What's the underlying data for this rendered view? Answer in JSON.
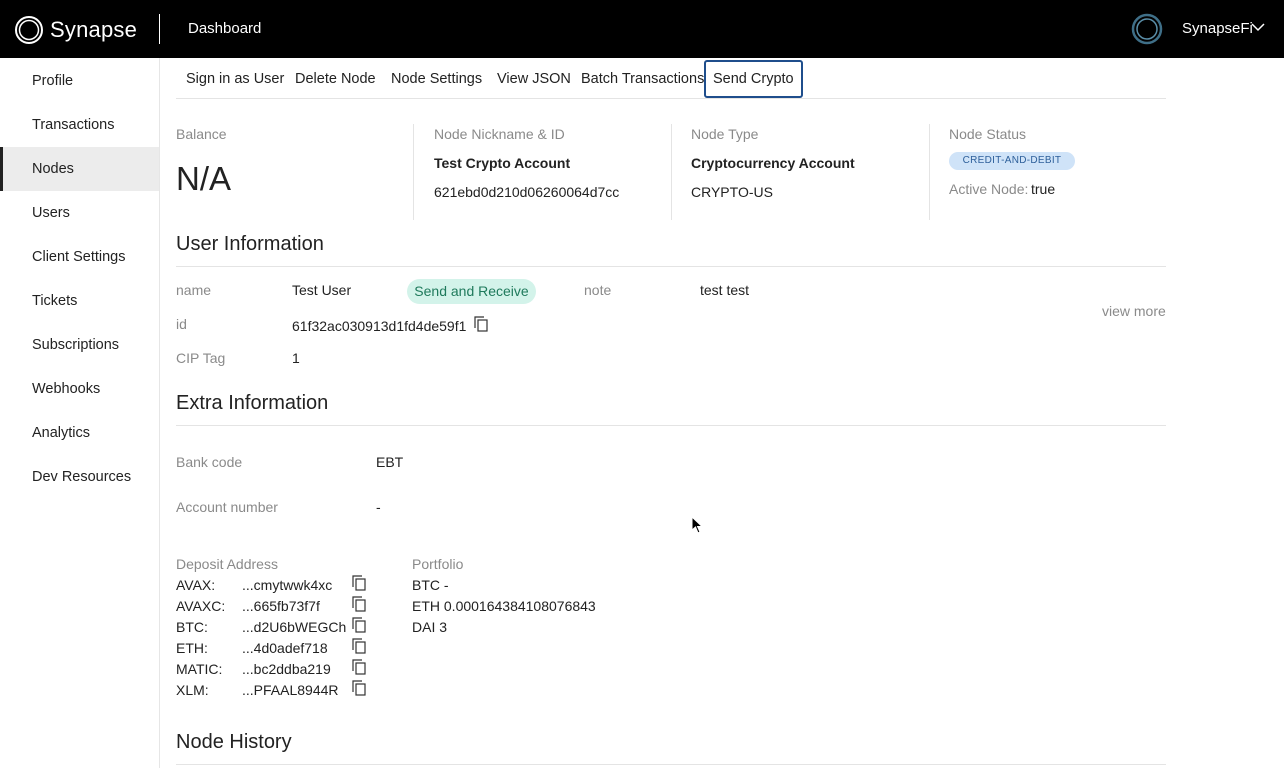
{
  "topbar": {
    "logo_text": "Synapse",
    "page_title": "Dashboard",
    "org_name": "SynapseFi"
  },
  "sidebar": {
    "items": [
      {
        "label": "Profile"
      },
      {
        "label": "Transactions"
      },
      {
        "label": "Nodes"
      },
      {
        "label": "Users"
      },
      {
        "label": "Client Settings"
      },
      {
        "label": "Tickets"
      },
      {
        "label": "Subscriptions"
      },
      {
        "label": "Webhooks"
      },
      {
        "label": "Analytics"
      },
      {
        "label": "Dev Resources"
      }
    ],
    "active": "Nodes"
  },
  "actions": {
    "sign_in": "Sign in as User",
    "delete": "Delete Node",
    "settings": "Node Settings",
    "view_json": "View JSON",
    "batch": "Batch Transactions",
    "send_crypto": "Send Crypto"
  },
  "summary": {
    "balance_label": "Balance",
    "balance_value": "N/A",
    "nickname_label": "Node Nickname & ID",
    "nickname": "Test Crypto Account",
    "node_id": "621ebd0d210d06260064d7cc",
    "type_label": "Node Type",
    "type": "Cryptocurrency Account",
    "type_code": "CRYPTO-US",
    "status_label": "Node Status",
    "status_badge": "CREDIT-AND-DEBIT",
    "active_label": "Active Node:",
    "active_value": "true"
  },
  "user_info": {
    "title": "User Information",
    "name_label": "name",
    "name": "Test User",
    "permission_badge": "Send and Receive",
    "note_label": "note",
    "note": "test test",
    "id_label": "id",
    "id": "61f32ac030913d1fd4de59f1",
    "cip_label": "CIP Tag",
    "cip": "1",
    "view_more": "view more"
  },
  "extra_info": {
    "title": "Extra Information",
    "bank_code_label": "Bank code",
    "bank_code": "EBT",
    "account_number_label": "Account number",
    "account_number": "-",
    "deposit_label": "Deposit Address",
    "deposit": [
      {
        "coin": "AVAX:",
        "addr": "...cmytwwk4xc"
      },
      {
        "coin": "AVAXC:",
        "addr": "...665fb73f7f"
      },
      {
        "coin": "BTC:",
        "addr": "...d2U6bWEGCh"
      },
      {
        "coin": "ETH:",
        "addr": "...4d0adef718"
      },
      {
        "coin": "MATIC:",
        "addr": "...bc2ddba219"
      },
      {
        "coin": "XLM:",
        "addr": "...PFAAL8944R"
      }
    ],
    "portfolio_label": "Portfolio",
    "portfolio": [
      "BTC -",
      "ETH 0.000164384108076843",
      "DAI 3"
    ]
  },
  "node_history": {
    "title": "Node History"
  }
}
